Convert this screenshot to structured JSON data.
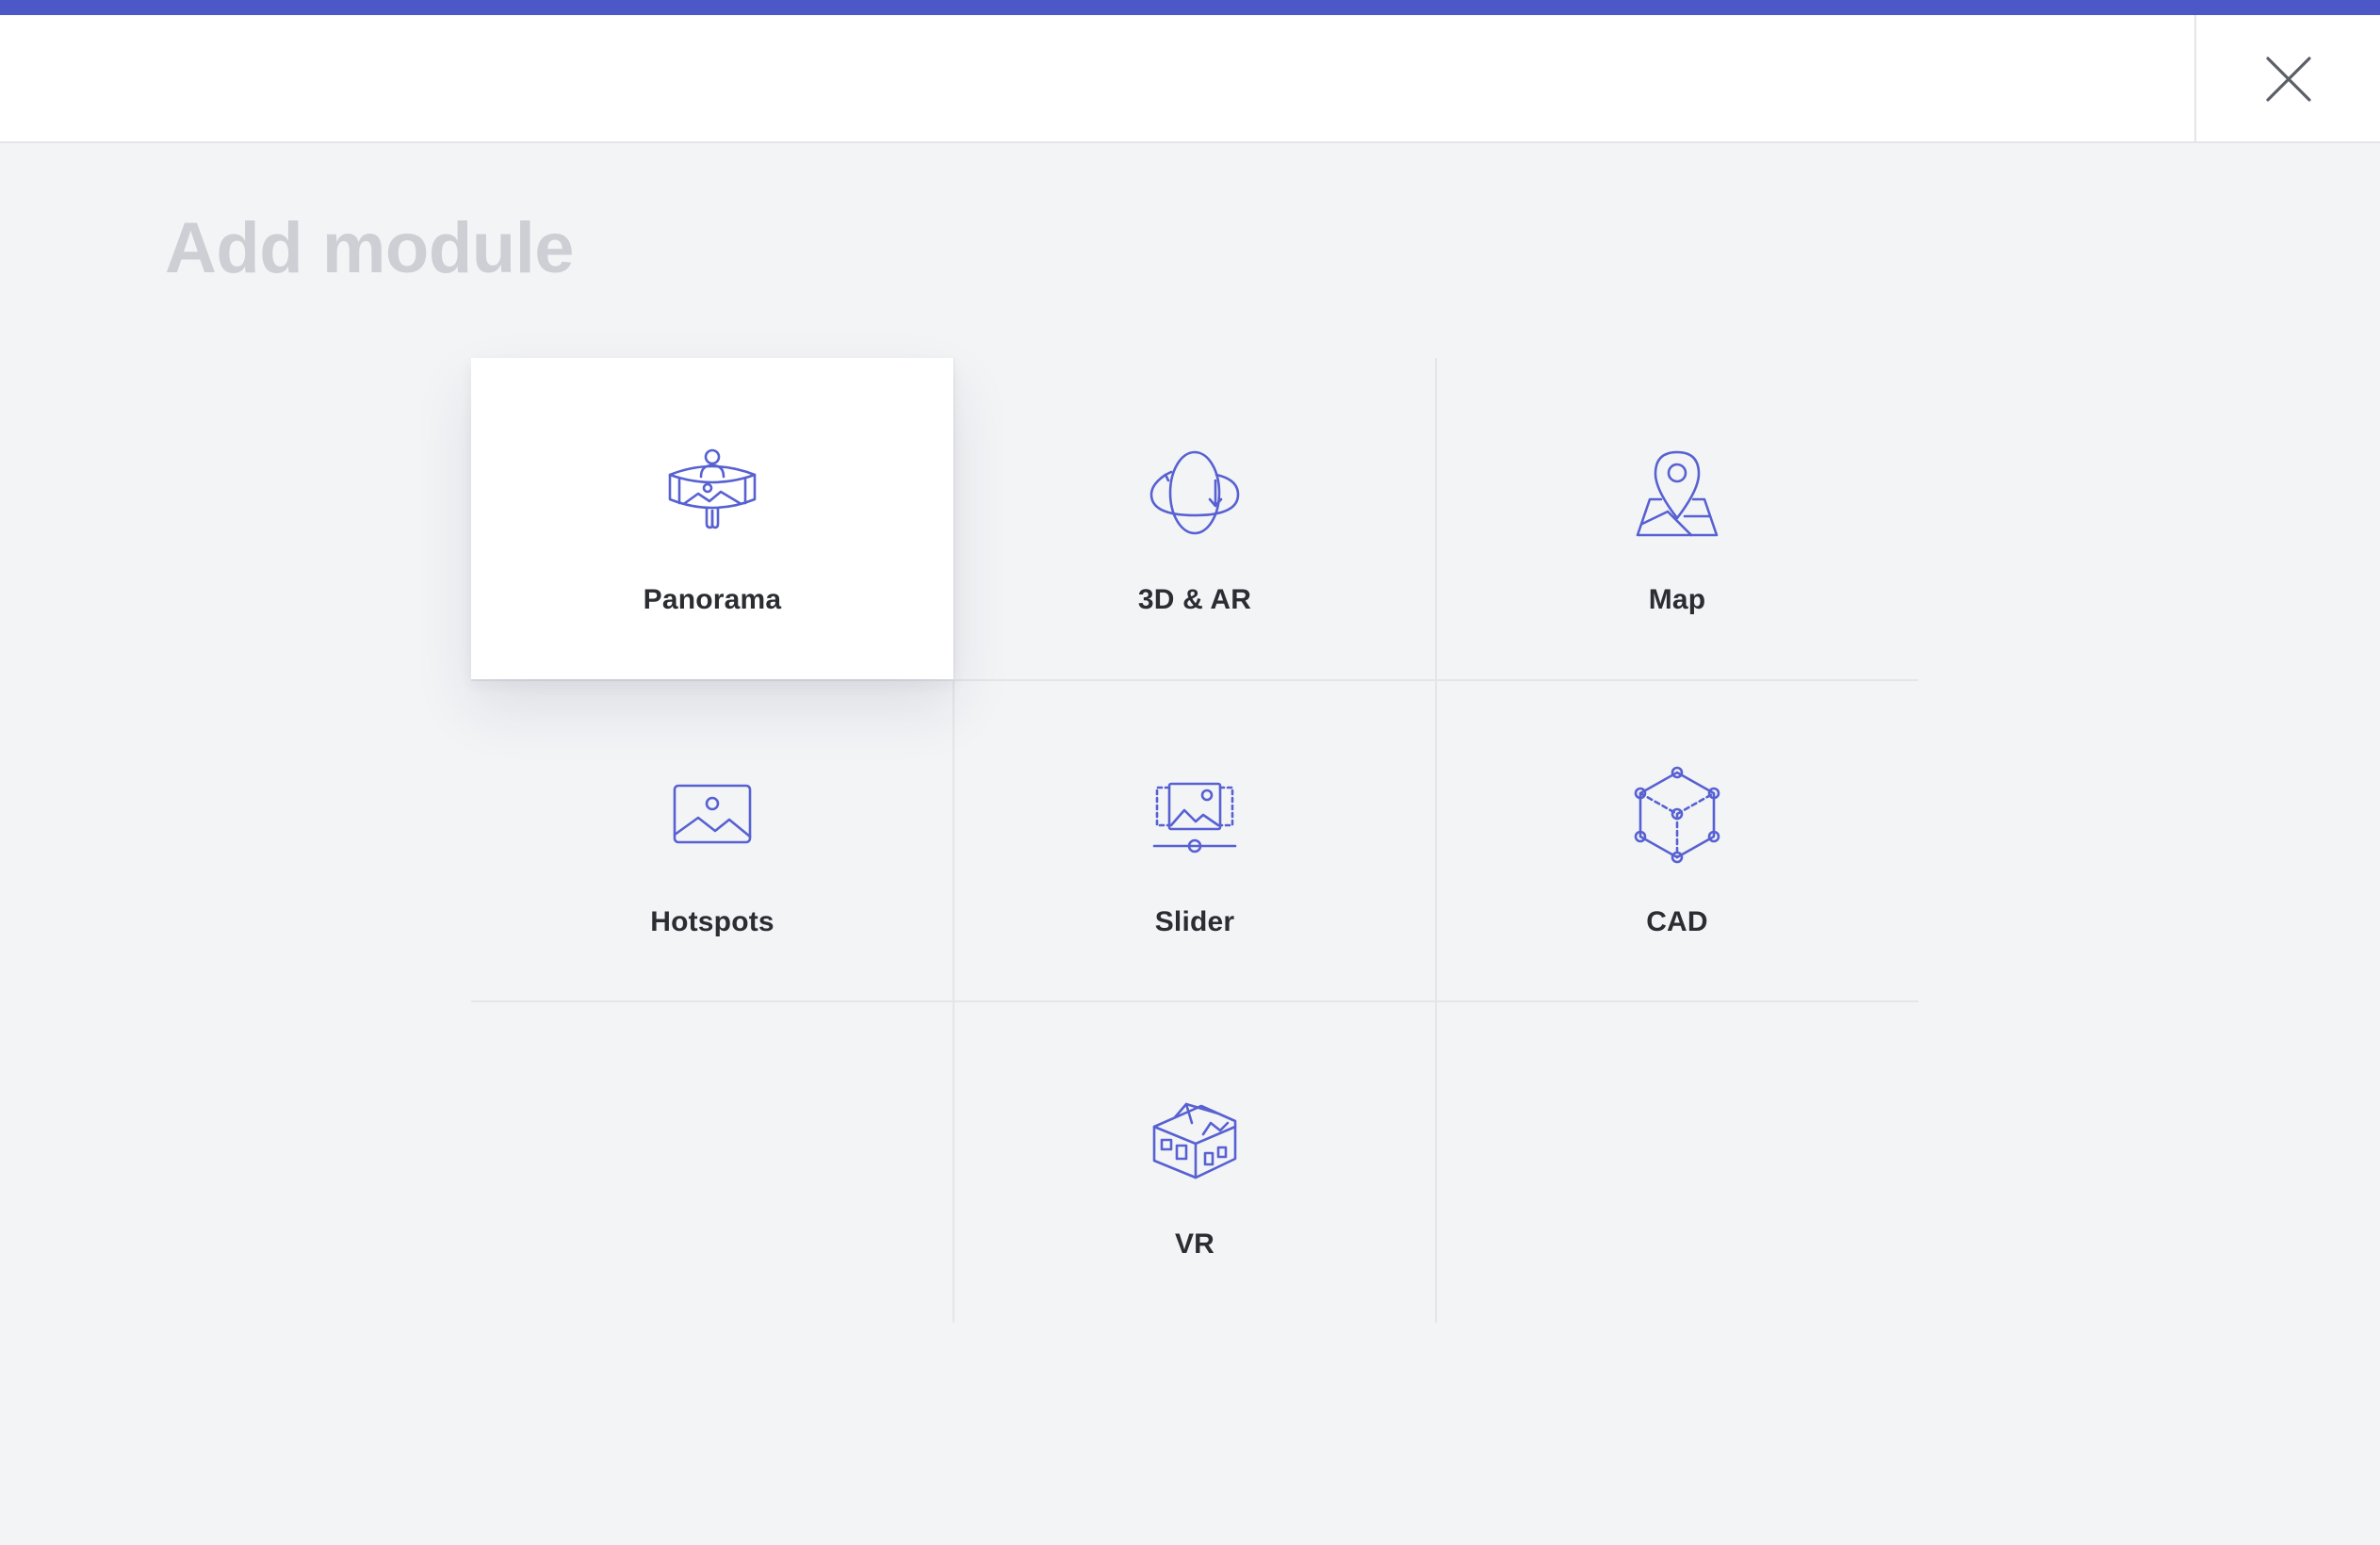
{
  "header": {
    "accent_color": "#4d58c8",
    "close_icon": "close-icon"
  },
  "page": {
    "title": "Add module"
  },
  "modules": [
    {
      "label": "Panorama",
      "icon": "panorama-icon",
      "selected": true
    },
    {
      "label": "3D & AR",
      "icon": "3d-ar-icon"
    },
    {
      "label": "Map",
      "icon": "map-pin-icon"
    },
    {
      "label": "Hotspots",
      "icon": "image-icon"
    },
    {
      "label": "Slider",
      "icon": "slider-icon"
    },
    {
      "label": "CAD",
      "icon": "cad-cube-icon"
    },
    {
      "label": "VR",
      "icon": "vr-house-icon"
    }
  ],
  "colors": {
    "icon_stroke": "#5761d1",
    "title": "#cdcfd5",
    "background": "#f3f4f6"
  }
}
